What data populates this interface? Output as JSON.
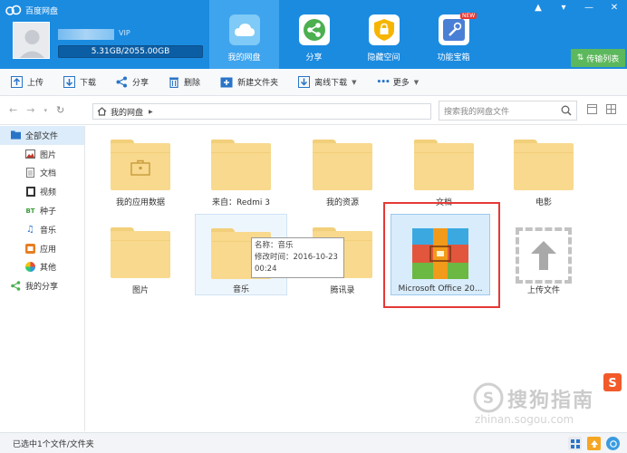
{
  "app": {
    "title": "百度网盘",
    "quota": "5.31GB/2055.00GB",
    "vip_badge": "VIP"
  },
  "nav": [
    {
      "label": "我的网盘",
      "icon": "cloud-icon",
      "color": "#5cb7f2"
    },
    {
      "label": "分享",
      "icon": "share-icon",
      "color": "#4caf50"
    },
    {
      "label": "隐藏空间",
      "icon": "lock-icon",
      "color": "#f6b500"
    },
    {
      "label": "功能宝箱",
      "icon": "toolbox-icon",
      "color": "#4a7fd6",
      "badge": "NEW"
    }
  ],
  "transfer_label": "传输列表",
  "toolbar": {
    "upload": "上传",
    "download": "下载",
    "share": "分享",
    "delete": "删除",
    "new_folder": "新建文件夹",
    "offline": "离线下载",
    "more": "更多"
  },
  "address": {
    "path": "我的网盘",
    "search_placeholder": "搜索我的网盘文件"
  },
  "sidebar": {
    "all_files": "全部文件",
    "items": [
      "图片",
      "文档",
      "视频",
      "种子",
      "音乐",
      "应用",
      "其他"
    ],
    "my_share": "我的分享"
  },
  "files": [
    {
      "name": "我的应用数据",
      "type": "folder-briefcase"
    },
    {
      "name": "来自：Redmi 3",
      "type": "folder"
    },
    {
      "name": "我的资源",
      "type": "folder"
    },
    {
      "name": "文档",
      "type": "folder"
    },
    {
      "name": "电影",
      "type": "folder"
    },
    {
      "name": "图片",
      "type": "folder"
    },
    {
      "name": "音乐",
      "type": "folder"
    },
    {
      "name": "腾讯录",
      "type": "folder"
    },
    {
      "name": "Microsoft Office 20...",
      "type": "archive"
    },
    {
      "name": "上传文件",
      "type": "upload"
    }
  ],
  "tooltip": {
    "line1": "名称：音乐",
    "line2": "修改时间：2016-10-23",
    "line3": "00:24"
  },
  "status": "已选中1个文件/文件夹",
  "watermark": {
    "text": "搜狗指南",
    "url": "zhinan.sogou.com"
  }
}
